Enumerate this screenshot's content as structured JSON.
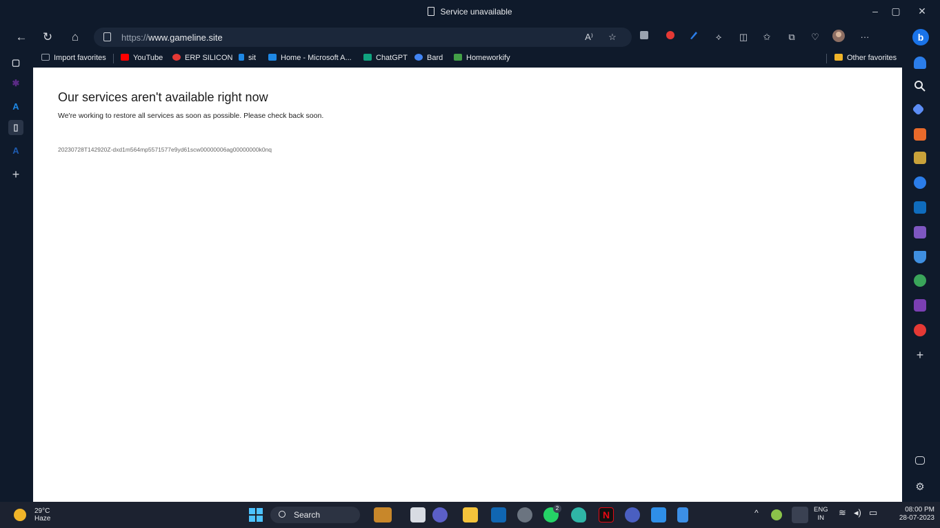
{
  "window": {
    "title": "Service unavailable",
    "controls": {
      "minimize": "–",
      "restore": "▢",
      "close": "✕"
    }
  },
  "nav": {
    "url_scheme": "https://",
    "url_host": "www.gameline.site",
    "reader_label": "A⁾",
    "more": "···"
  },
  "favorites": [
    {
      "label": "Import favorites",
      "color": "#9aa3b0"
    },
    {
      "label": "YouTube",
      "color": "#ff0000"
    },
    {
      "label": "ERP SILICON",
      "color": "#e53935"
    },
    {
      "label": "sit",
      "color": "#1e88e5"
    },
    {
      "label": "Home - Microsoft A...",
      "color": "#1e88e5"
    },
    {
      "label": "ChatGPT",
      "color": "#10a37f"
    },
    {
      "label": "Bard",
      "color": "#4285f4"
    },
    {
      "label": "Homeworkify",
      "color": "#43a047"
    }
  ],
  "other_favorites": "Other favorites",
  "page": {
    "heading": "Our services aren't available right now",
    "message": "We're working to restore all services as soon as possible. Please check back soon.",
    "reference": "20230728T142920Z-dxd1m564mp5571577e9yd61scw00000006ag00000000k0nq"
  },
  "taskbar": {
    "temperature": "29°C",
    "weather": "Haze",
    "search_label": "Search",
    "language": "ENG",
    "region": "IN",
    "time": "08:00 PM",
    "date": "28-07-2023",
    "whatsapp_badge": "2"
  }
}
